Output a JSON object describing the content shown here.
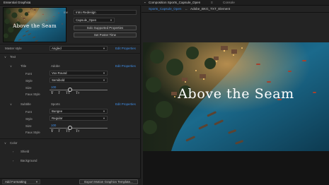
{
  "essential_graphics": {
    "tab_label": "Essential Graphics",
    "tab_menu": "≡",
    "thumbnail_title": "Above the Seam",
    "name_value": "Intro Redesign",
    "name_label": "me",
    "folder_value": "Capsule_Open",
    "solo_button": "Solo Supported Properties",
    "poster_button": "Set Poster Time",
    "master_style_label": "Master style",
    "master_style_value": "Angled",
    "edit_properties": "Edit Properties",
    "text_section": "Text",
    "title_row": {
      "label": "Title",
      "value": "Adobe",
      "edit": "Edit Properties",
      "font_label": "Font",
      "font_value": "Vox Round",
      "style_label": "Style",
      "style_value": "Semibold",
      "size_label": "Size",
      "size_value": "100",
      "fauxstyle_label": "Faux Style",
      "faux": [
        "T",
        "T",
        "TT",
        "Tт"
      ]
    },
    "subtitle_row": {
      "label": "Subtitle",
      "value": "Sports",
      "edit": "Edit Properties",
      "font_label": "Font",
      "font_value": "Bungee",
      "style_label": "Style",
      "style_value": "Regular",
      "size_label": "Size",
      "size_value": "100",
      "fauxstyle_label": "Faux Style",
      "faux": [
        "T",
        "T",
        "TT",
        "Tт"
      ]
    },
    "color_section": "Color",
    "color_items": [
      "Shield",
      "Background"
    ],
    "add_formatting": "Add Formatting",
    "export_button": "Export Motion Graphics Template..."
  },
  "composition": {
    "tab_label": "Composition Sports_Capsule_Open",
    "tab_menu": "≡",
    "console_tab": "Console",
    "breadcrumb": [
      "Sports_Capsule_Open",
      "Adobe_BKG_TXT_Element"
    ],
    "breadcrumb_sep": "←",
    "viewer_title": "Above the Seam"
  },
  "colors": {
    "accent": "#3f8ee8",
    "panel": "#232323",
    "water": "#1c6a8a"
  }
}
